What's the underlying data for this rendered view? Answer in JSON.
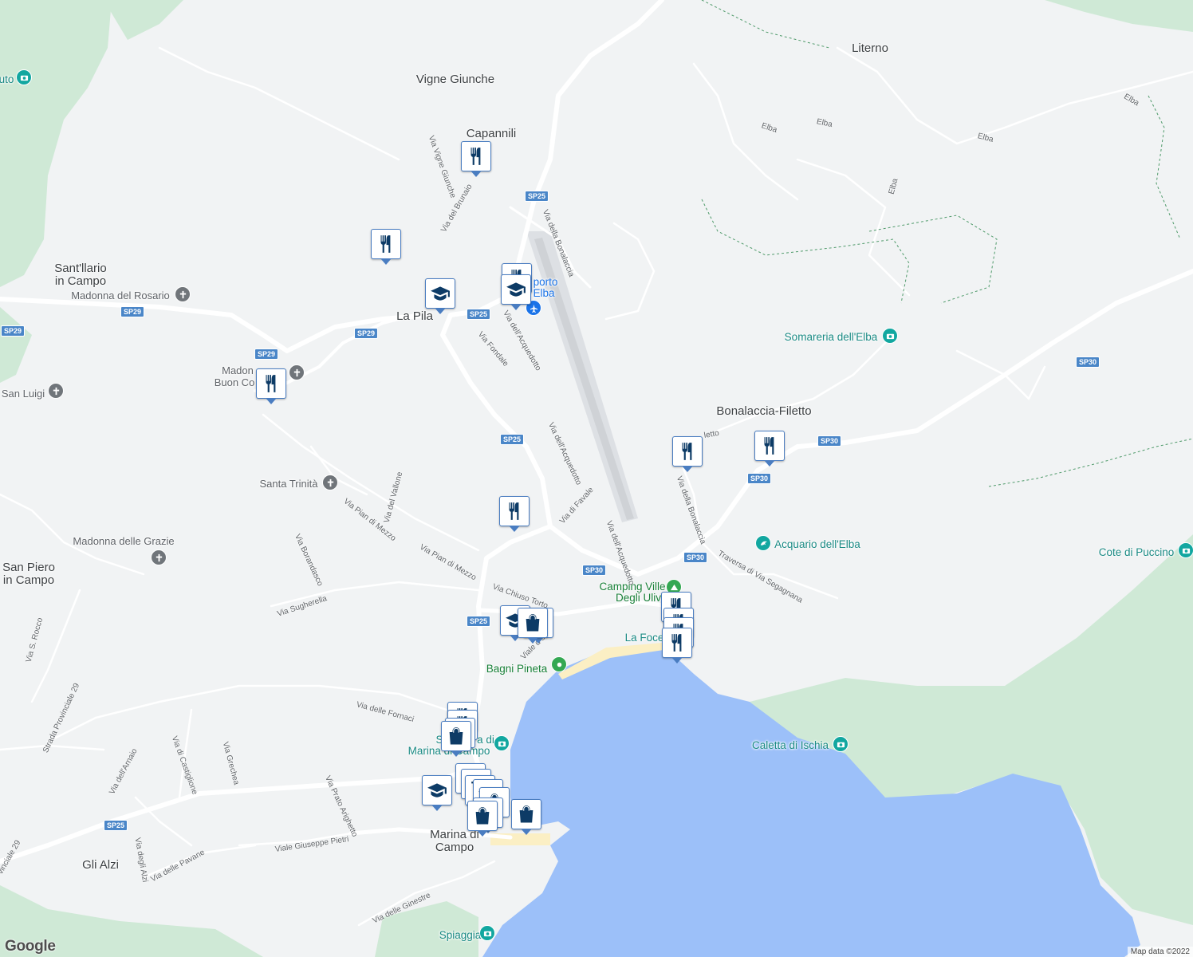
{
  "map": {
    "colors": {
      "land": "#f1f3f4",
      "park": "#cfe9d6",
      "water": "#9cc0f9",
      "beach": "#fbefc4",
      "road": "#ffffff",
      "major_road": "#ffffff",
      "airport": "#e3e5e8"
    },
    "place_labels": {
      "literno": "Literno",
      "vigne_giunche": "Vigne Giunche",
      "capannili": "Capannili",
      "santllario_1": "Sant'llario",
      "santllario_2": "in Campo",
      "la_pila": "La Pila",
      "bonalaccia": "Bonalaccia-Filetto",
      "san_piero_1": "San Piero",
      "san_piero_2": "in Campo",
      "marina_1": "Marina di",
      "marina_2": "Campo",
      "gli_alzi": "Gli Alzi",
      "aeroporto_1": "porto",
      "aeroporto_2": "Elba"
    },
    "poi_labels": {
      "madonna_rosario": "Madonna del Rosario",
      "madonna_buon_1": "Madon",
      "madonna_buon_2": "Buon Co",
      "san_luigi": "San Luigi",
      "santa_trinita": "Santa Trinità",
      "madonna_grazie": "Madonna delle Grazie",
      "somareria": "Somareria dell'Elba",
      "acquario": "Acquario dell'Elba",
      "cote_puccino": "Cote di Puccino",
      "camping_1": "Camping Ville",
      "camping_2": "Degli Ulivi",
      "la_foce": "La Foce",
      "bagni_pineta": "Bagni Pineta",
      "spiaggia_marina_1": "S",
      "spiaggia_marina_1b": "a di",
      "spiaggia_marina_2": "Marina di Campo",
      "caletta": "Caletta di Ischia",
      "spiaggia": "Spiaggia",
      "left_edge": "uto"
    },
    "road_names": {
      "elba_1": "Elba",
      "elba_2": "Elba",
      "elba_3": "Elba",
      "elba_4": "Elba",
      "elba_5": "Elba",
      "vigne_giunche": "Via Vigne Giunche",
      "brunaio": "Via del Brunaio",
      "bonalaccia": "Via della Bonalaccia",
      "acquedotto_1": "Via dell'Acquedotto",
      "acquedotto_2": "Via dell'Acquedotto",
      "acquedotto_3": "Via dell'Acquedotto",
      "fondale": "Via Fondale",
      "favale": "Via di Favale",
      "bonalaccia_2": "Via della Bonalaccia",
      "traversa": "Traversa di Via Segagnana",
      "filetto": "letto",
      "vallone": "Via del Vallone",
      "pian_mezzo_1": "Via Pian di Mezzo",
      "pian_mezzo_2": "Via Pian di Mezzo",
      "borandasco": "Via Borandasco",
      "chiuso_torto": "Via Chiuso Torto",
      "sugherella": "Via Sugherella",
      "viale_schi": "Viale d    schi",
      "rocco": "Via S. Rocco",
      "fornaci": "Via delle Fornaci",
      "provinciale_29": "Strada Provinciale 29",
      "arnaio": "Via dell'Arnaio",
      "castiglione": "Via di Castiglione",
      "grechea": "Via Grechea",
      "prato": "Via Prato Arighetto",
      "pietri": "Viale Giuseppe Pietri",
      "alzi": "Via degli Alzi",
      "pavane": "Via delle Pavane",
      "ginestre": "Via delle Ginestre",
      "provinciale_29b": "vinciale 29"
    },
    "shields": {
      "sp25": "SP25",
      "sp29": "SP29",
      "sp30": "SP30"
    },
    "markers": [
      "restaurant-marker",
      "school-marker",
      "shopping-marker",
      "cart-marker"
    ],
    "attribution": "Map data ©2022",
    "logo": "Google"
  }
}
